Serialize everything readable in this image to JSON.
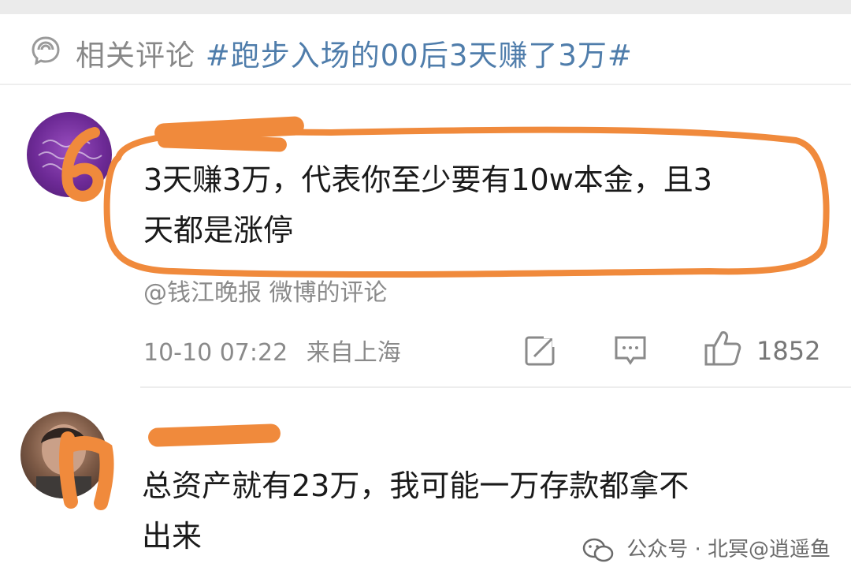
{
  "header": {
    "icon": "comment-bubble-icon",
    "label": "相关评论",
    "topic": "#跑步入场的00后3天赚了3万#"
  },
  "comments": [
    {
      "username": "",
      "avatar": "avatar-purple",
      "lines": [
        "3天赚3万，代表你至少要有10w本金，且3",
        "天都是涨停"
      ],
      "source": "@钱江晚报 微博的评论",
      "time": "10-10 07:22",
      "location": "来自上海",
      "likes": "1852",
      "icons": [
        "repost-icon",
        "comment-icon",
        "like-icon"
      ]
    },
    {
      "username": "",
      "avatar": "avatar-photo",
      "lines": [
        "总资产就有23万，我可能一万存款都拿不",
        "出来"
      ]
    }
  ],
  "watermark": {
    "icon": "wechat-icon",
    "text": "公众号 · 北冥@逍遥鱼"
  },
  "annotation": {
    "marker_color": "#f08a3c"
  }
}
